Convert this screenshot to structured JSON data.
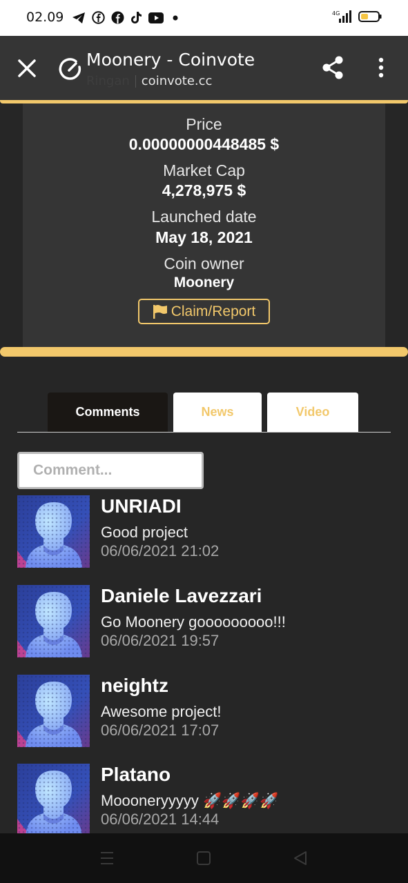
{
  "status_bar": {
    "time": "02.09",
    "network": "4G",
    "icons": [
      "telegram-icon",
      "facebook-icon",
      "facebook-icon",
      "tiktok-icon",
      "youtube-icon",
      "notification-dot",
      "signal-icon",
      "battery-icon"
    ]
  },
  "app_bar": {
    "title": "Moonery - Coinvote",
    "subtitle_faded": "Ringan",
    "domain": "coinvote.cc",
    "icons": [
      "close-icon",
      "gauge-icon",
      "share-icon",
      "more-vert-icon"
    ]
  },
  "coin_info": {
    "price_label": "Price",
    "price_value": "0.00000000448485 $",
    "market_cap_label": "Market Cap",
    "market_cap_value": "4,278,975 $",
    "launched_label": "Launched date",
    "launched_value": "May 18, 2021",
    "owner_label": "Coin owner",
    "owner_value": "Moonery",
    "claim_label": "Claim/Report"
  },
  "tabs": [
    {
      "label": "Comments",
      "active": true
    },
    {
      "label": "News",
      "active": false
    },
    {
      "label": "Video",
      "active": false
    }
  ],
  "comment_input": {
    "placeholder": "Comment...",
    "value": ""
  },
  "comments": [
    {
      "name": "UNRIADI",
      "text": "Good project",
      "time": "06/06/2021 21:02"
    },
    {
      "name": "Daniele Lavezzari",
      "text": "Go Moonery gooooooooo!!!",
      "time": "06/06/2021 19:57"
    },
    {
      "name": "neightz",
      "text": "Awesome project!",
      "time": "06/06/2021 17:07"
    },
    {
      "name": "Platano",
      "text": "Moooneryyyyy 🚀🚀🚀🚀",
      "time": "06/06/2021 14:44"
    }
  ],
  "colors": {
    "accent_gold": "#f2c86b",
    "background": "#262626",
    "card": "#353535",
    "active_tab": "#1a1714"
  }
}
